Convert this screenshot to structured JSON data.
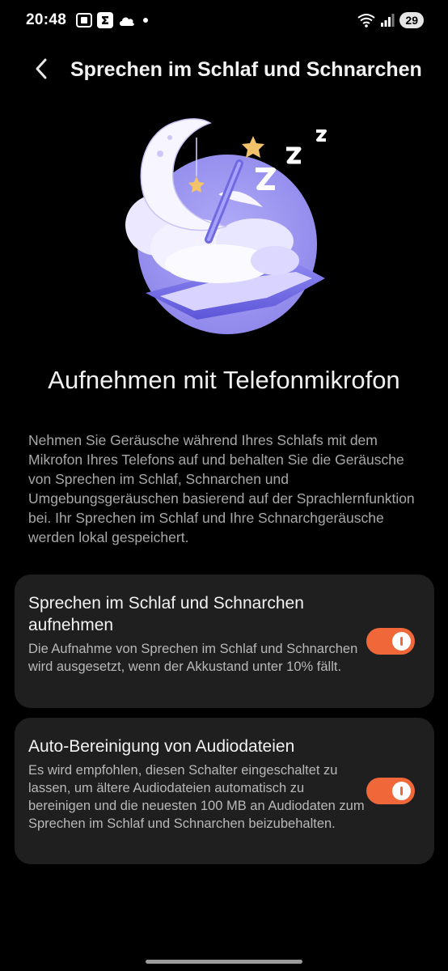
{
  "status_bar": {
    "time": "20:48",
    "left_icons": [
      "screenshot-icon",
      "sigma-icon",
      "cloud-icon",
      "dot-icon"
    ],
    "right_icons": [
      "wifi-icon",
      "signal-icon"
    ],
    "battery": "29"
  },
  "header": {
    "back_icon": "chevron-left-icon",
    "title": "Sprechen im Schlaf und Schnarchen"
  },
  "main": {
    "illustration": "sleeping-moon-illustration",
    "heading": "Aufnehmen mit Telefonmikrofon",
    "description": "Nehmen Sie Geräusche während Ihres Schlafs mit dem Mikrofon Ihres Telefons auf und behalten Sie die Geräusche von Sprechen im Schlaf, Schnarchen und Umgebungsgeräuschen basierend auf der Sprachlernfunktion bei. Ihr Sprechen im Schlaf und Ihre Schnarchgeräusche werden lokal gespeichert."
  },
  "settings": [
    {
      "title": "Sprechen im Schlaf und Schnarchen aufnehmen",
      "description": "Die Aufnahme von Sprechen im Schlaf und Schnarchen wird ausgesetzt, wenn der Akkustand unter 10% fällt.",
      "enabled": true
    },
    {
      "title": "Auto-Bereinigung von Audiodateien",
      "description": "Es wird empfohlen, diesen Schalter eingeschaltet zu lassen, um ältere Audiodateien automatisch zu bereinigen und die neuesten 100 MB an Audiodaten zum Sprechen im Schlaf und Schnarchen beizubehalten.",
      "enabled": true
    }
  ],
  "colors": {
    "accent": "#f0683a",
    "background": "#000000",
    "card": "#1f1f1f",
    "illustration_circle": "#9b95f0"
  }
}
